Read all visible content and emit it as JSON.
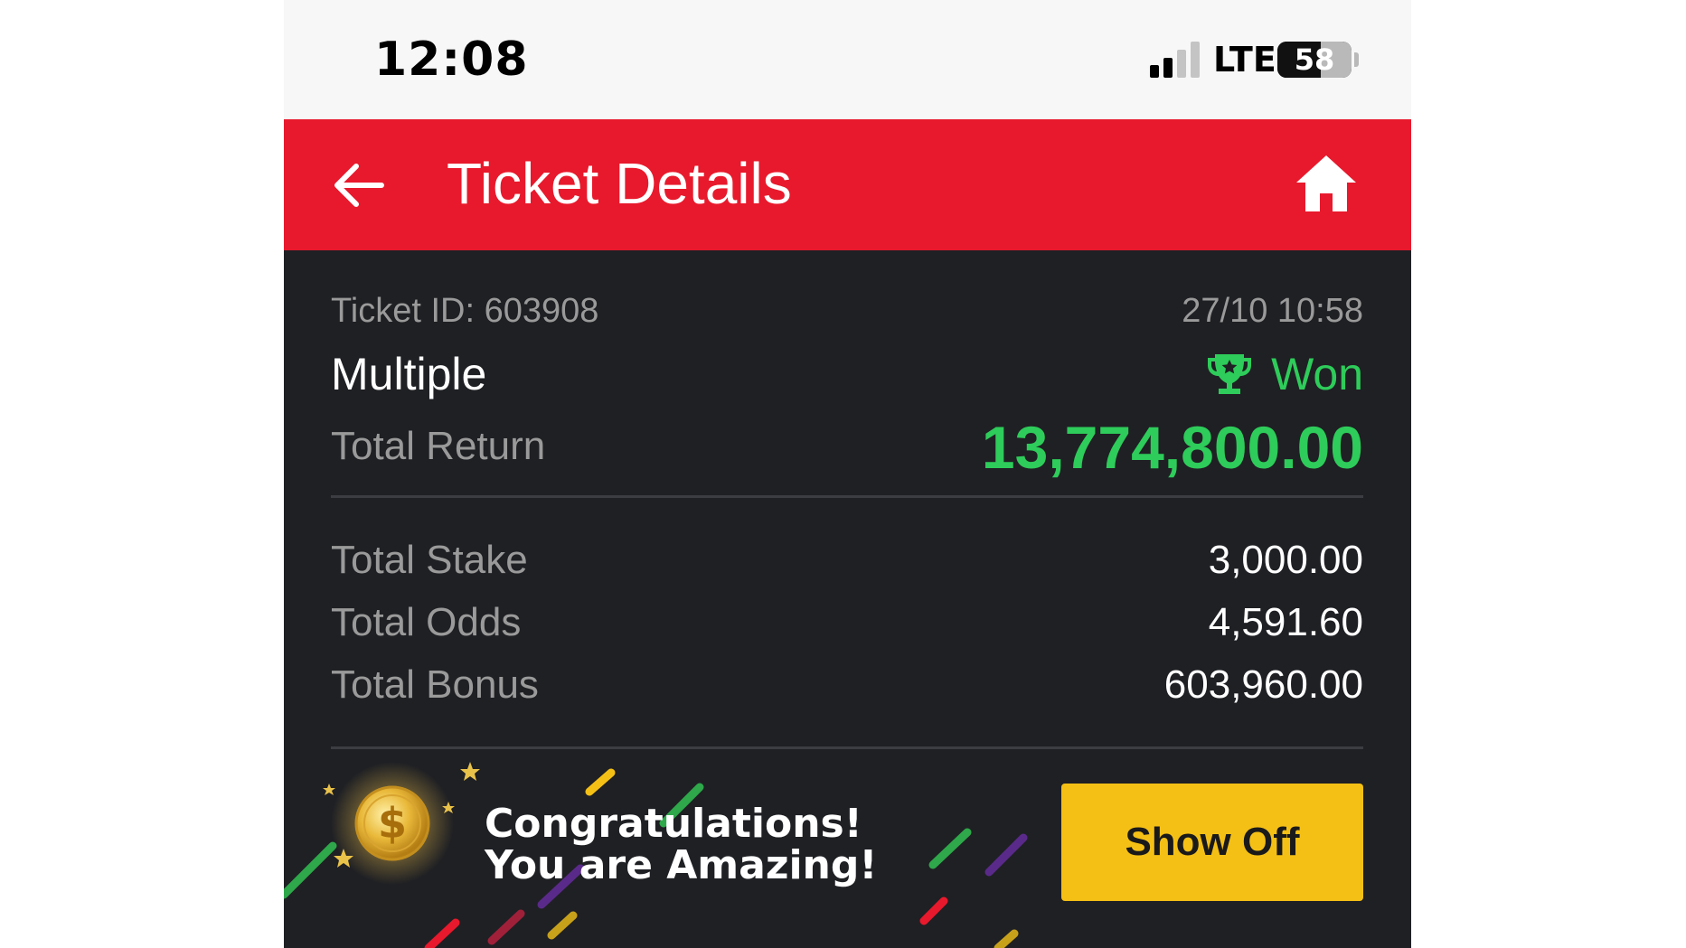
{
  "status_bar": {
    "time": "12:08",
    "network": "LTE",
    "battery_level": "58",
    "battery_fraction": 0.58,
    "signal_bars_active": 2,
    "signal_bars_total": 4
  },
  "header": {
    "title": "Ticket Details",
    "back_icon": "arrow-left-icon",
    "home_icon": "home-icon",
    "background_color": "#e8192c"
  },
  "ticket": {
    "id_label": "Ticket ID: 603908",
    "datetime": "27/10 10:58",
    "type": "Multiple",
    "status": "Won",
    "status_icon": "trophy-icon",
    "status_color": "#2ecc5a",
    "total_return_label": "Total Return",
    "total_return": "13,774,800.00",
    "total_stake_label": "Total Stake",
    "total_stake": "3,000.00",
    "total_odds_label": "Total Odds",
    "total_odds": "4,591.60",
    "total_bonus_label": "Total Bonus",
    "total_bonus": "603,960.00"
  },
  "banner": {
    "line1": "Congratulations!",
    "line2": "You are Amazing!",
    "coin_icon": "dollar-coin-icon",
    "button_label": "Show Off",
    "button_color": "#f5c015"
  }
}
